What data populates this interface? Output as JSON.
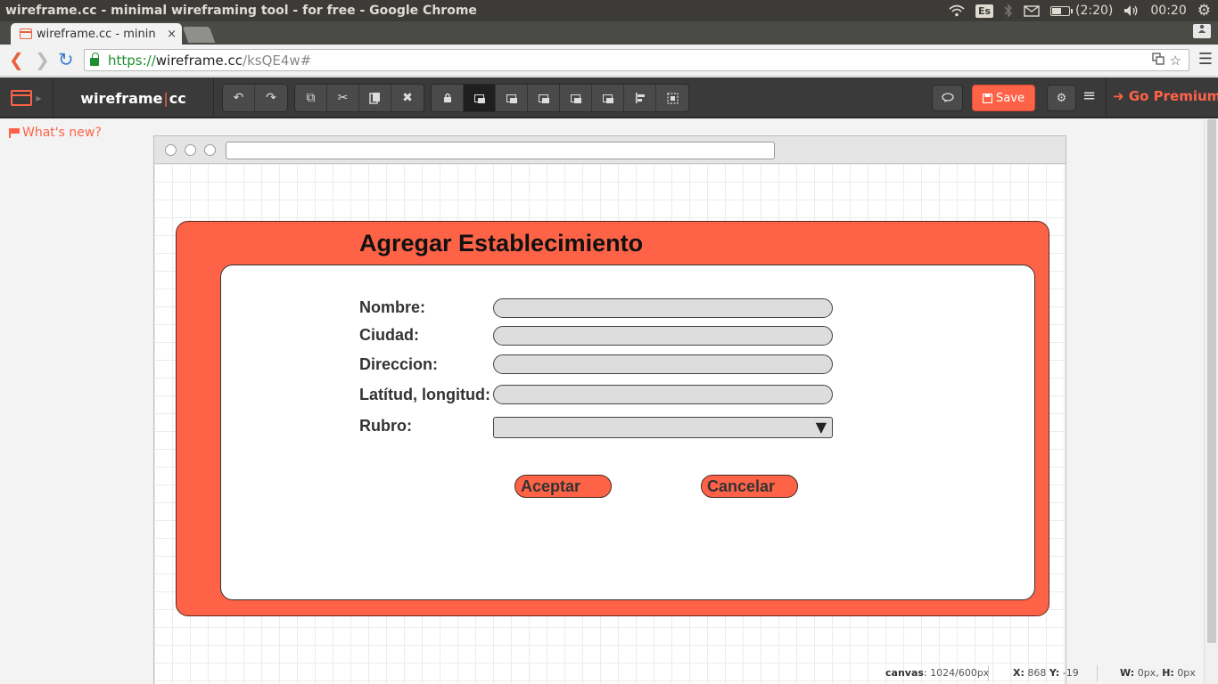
{
  "os": {
    "window_title": "wireframe.cc - minimal wireframing tool - for free - Google Chrome",
    "keyboard_layout": "Es",
    "battery_text": "(2:20)",
    "battery_level": 0.6,
    "clock": "00:20"
  },
  "browser": {
    "tab_title": "wireframe.cc - minin",
    "tab_close": "×",
    "url_scheme": "https://",
    "url_host": "wireframe.cc",
    "url_path": "/ksQE4w#"
  },
  "app": {
    "brand_left": "wireframe",
    "brand_sep": "|",
    "brand_right": "cc",
    "save_label": "Save",
    "premium_label": "Go Premium",
    "whats_new": "What's new?",
    "accent_color": "#ff6347"
  },
  "form": {
    "title": "Agregar Establecimiento",
    "fields": [
      {
        "label": "Nombre:",
        "value": ""
      },
      {
        "label": "Ciudad:",
        "value": ""
      },
      {
        "label": "Direccion:",
        "value": ""
      },
      {
        "label": "Latítud, longitud:",
        "value": ""
      }
    ],
    "select": {
      "label": "Rubro:",
      "value": ""
    },
    "accept_label": "Aceptar",
    "cancel_label": "Cancelar"
  },
  "status": {
    "canvas_label": "canvas",
    "canvas_value": ": 1024/600px",
    "x_label": "X:",
    "x_value": "868",
    "y_label": "Y:",
    "y_value": "-19",
    "w_label": "W:",
    "w_value": "0px,",
    "h_label": "H:",
    "h_value": "0px"
  }
}
